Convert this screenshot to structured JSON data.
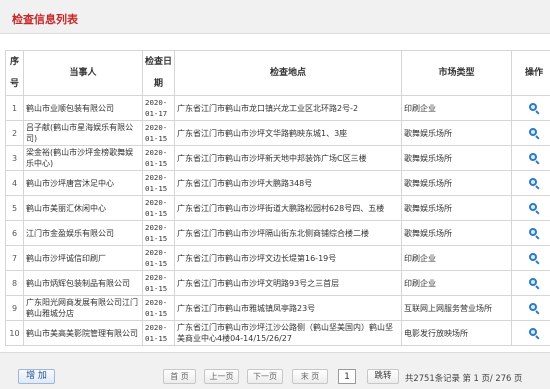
{
  "page": {
    "title": "检查信息列表"
  },
  "table": {
    "headers": {
      "no": "序号",
      "party": "当事人",
      "date": "检查日期",
      "location": "检查地点",
      "market_type": "市场类型",
      "operation": "操作"
    },
    "rows": [
      {
        "no": "1",
        "party": "鹤山市业顺包装有限公司",
        "date": "2020-01-17",
        "location": "广东省江门市鹤山市龙口镇兴龙工业区北环路2号-2",
        "market_type": "印刷企业"
      },
      {
        "no": "2",
        "party": "吕子献(鹤山市星海娱乐有限公司)",
        "date": "2020-01-15",
        "location": "广东省江门市鹤山市沙坪文华路鹤映东城1、3座",
        "market_type": "歌舞娱乐场所"
      },
      {
        "no": "3",
        "party": "梁金裕(鹤山市沙坪金榜歌舞娱乐中心)",
        "date": "2020-01-15",
        "location": "广东省江门市鹤山市沙坪新天地中邦装饰广场C区三楼",
        "market_type": "歌舞娱乐场所"
      },
      {
        "no": "4",
        "party": "鹤山市沙坪唐宫沐足中心",
        "date": "2020-01-15",
        "location": "广东省江门市鹤山市沙坪大鹏路348号",
        "market_type": "歌舞娱乐场所"
      },
      {
        "no": "5",
        "party": "鹤山市美丽汇休闲中心",
        "date": "2020-01-15",
        "location": "广东省江门市鹤山市沙坪街道大鹏路松园村628号四、五楼",
        "market_type": "歌舞娱乐场所"
      },
      {
        "no": "6",
        "party": "江门市金盈娱乐有限公司",
        "date": "2020-01-15",
        "location": "广东省江门市鹤山市沙坪隔山街东北侧商铺综合楼二楼",
        "market_type": "歌舞娱乐场所"
      },
      {
        "no": "7",
        "party": "鹤山市沙坪诚信印刷厂",
        "date": "2020-01-15",
        "location": "广东省江门市鹤山市沙坪文边长堤第16-19号",
        "market_type": "印刷企业"
      },
      {
        "no": "8",
        "party": "鹤山市炳辉包装制品有限公司",
        "date": "2020-01-15",
        "location": "广东省江门市鹤山市沙坪文明路93号之三首层",
        "market_type": "印刷企业"
      },
      {
        "no": "9",
        "party": "广东阳光网商发展有限公司江门鹤山雅城分店",
        "date": "2020-01-15",
        "location": "广东省江门市鹤山市雅城镇凤亭路23号",
        "market_type": "互联网上网服务营业场所"
      },
      {
        "no": "10",
        "party": "鹤山市美高美影院管理有限公司",
        "date": "2020-01-15",
        "location": "广东省江门市鹤山市沙坪江沙公路侧（鹤山坚美国内）鹤山坚美商业中心4楼04-14/15/26/27",
        "market_type": "电影发行放映场所"
      }
    ]
  },
  "toolbar": {
    "add_label": "增 加",
    "first_label": "首 页",
    "prev_label": "上一页",
    "next_label": "下一页",
    "last_label": "末 页",
    "page_value": "1",
    "jump_label": "跳转",
    "summary": "共2751条记录 第 1 页/ 276 页"
  },
  "icons": {
    "operation": "search-icon"
  },
  "colors": {
    "title": "#c62828",
    "icon": "#2b7bc8",
    "border": "#d6d6d6"
  }
}
